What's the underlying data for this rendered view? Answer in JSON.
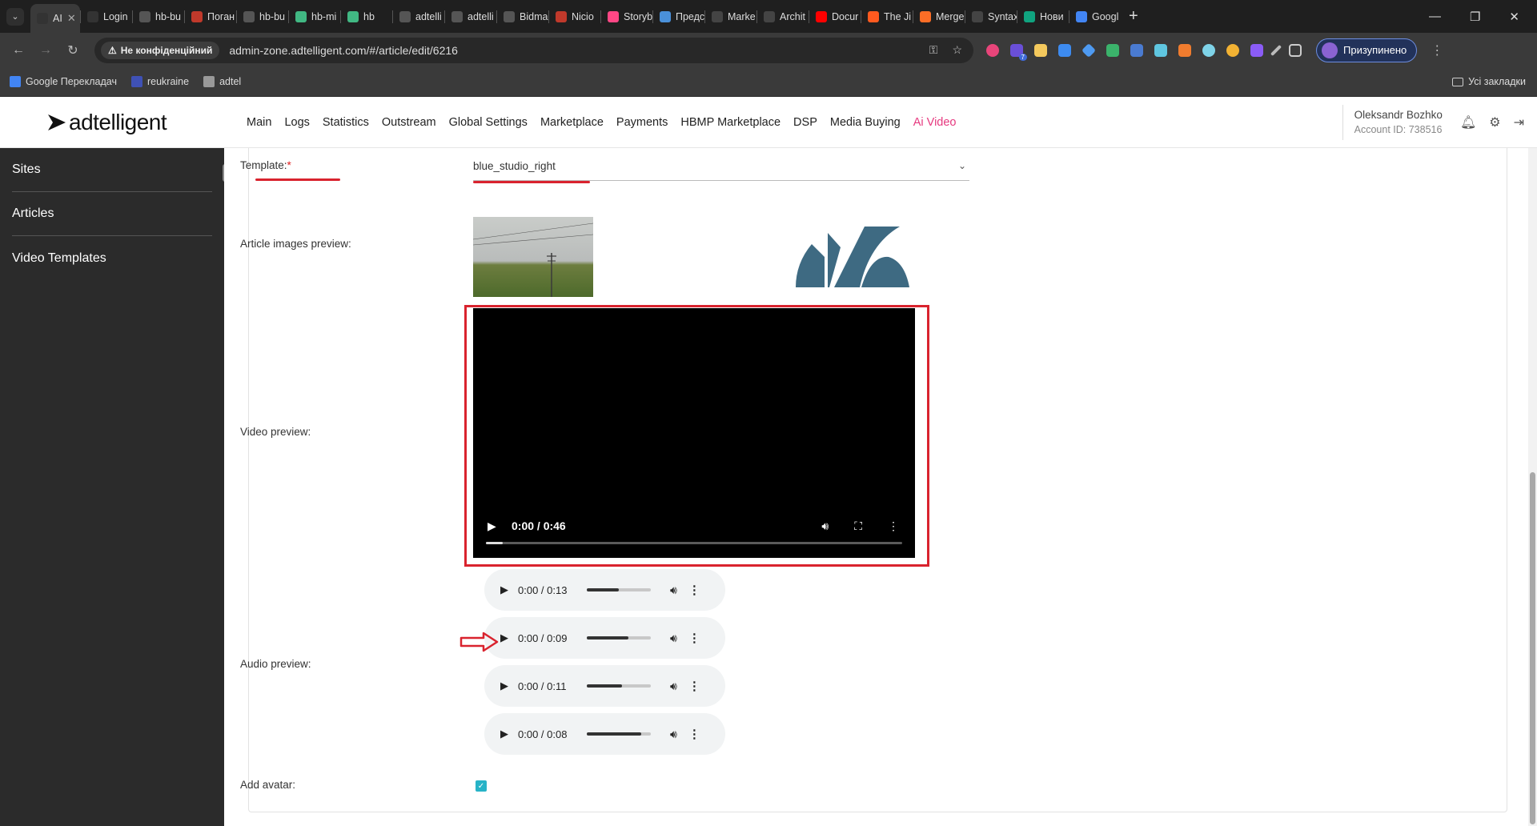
{
  "browser": {
    "tabs": [
      {
        "label": "AI",
        "icon": "adtelligent-icon",
        "color": "#333333",
        "active": true
      },
      {
        "label": "Login",
        "icon": "adtelligent-icon",
        "color": "#333333"
      },
      {
        "label": "hb-bu",
        "icon": "globe-icon",
        "color": "#555555"
      },
      {
        "label": "Поган",
        "icon": "bug-icon",
        "color": "#c0392b"
      },
      {
        "label": "hb-bu",
        "icon": "globe-icon",
        "color": "#555555"
      },
      {
        "label": "hb-mi",
        "icon": "vue-icon",
        "color": "#41b883"
      },
      {
        "label": "hb",
        "icon": "vue-icon",
        "color": "#41b883"
      },
      {
        "label": "adtelli",
        "icon": "globe-icon",
        "color": "#555555"
      },
      {
        "label": "adtelli",
        "icon": "globe-icon",
        "color": "#555555"
      },
      {
        "label": "Bidma",
        "icon": "globe-icon",
        "color": "#555555"
      },
      {
        "label": "Nicio",
        "icon": "book-icon",
        "color": "#c0392b"
      },
      {
        "label": "Storyb",
        "icon": "storybook-icon",
        "color": "#ff4785"
      },
      {
        "label": "Предс",
        "icon": "image-icon",
        "color": "#4a90d9"
      },
      {
        "label": "Marke",
        "icon": "x-icon",
        "color": "#444444"
      },
      {
        "label": "Archit",
        "icon": "notion-icon",
        "color": "#444444"
      },
      {
        "label": "Docur",
        "icon": "youtube-icon",
        "color": "#ff0000"
      },
      {
        "label": "The Ji",
        "icon": "flame-icon",
        "color": "#ff5a1f"
      },
      {
        "label": "Merge",
        "icon": "gitlab-icon",
        "color": "#fc6d26"
      },
      {
        "label": "Syntax",
        "icon": "x-icon",
        "color": "#444444"
      },
      {
        "label": "Нови",
        "icon": "chatgpt-icon",
        "color": "#10a37f"
      },
      {
        "label": "Googl",
        "icon": "translate-icon",
        "color": "#4285f4"
      }
    ],
    "omnibox": {
      "security_badge": "Не конфіденційний",
      "url": "admin-zone.adtelligent.com/#/article/edit/6216"
    },
    "profile_status": "Призупинено",
    "extension_badge": "7",
    "bookmarks": [
      {
        "label": "Google Перекладач",
        "icon": "translate-icon",
        "color": "#4285f4"
      },
      {
        "label": "reukraine",
        "icon": "reukraine-icon",
        "color": "#3f51b5"
      },
      {
        "label": "adtel",
        "icon": "folder-icon",
        "color": "#999999"
      }
    ],
    "all_bookmarks": "Усі закладки"
  },
  "app": {
    "logo_text": "adtelligent",
    "nav": [
      {
        "label": "Main"
      },
      {
        "label": "Logs"
      },
      {
        "label": "Statistics"
      },
      {
        "label": "Outstream"
      },
      {
        "label": "Global Settings"
      },
      {
        "label": "Marketplace"
      },
      {
        "label": "Payments"
      },
      {
        "label": "HBMP Marketplace"
      },
      {
        "label": "DSP"
      },
      {
        "label": "Media Buying"
      },
      {
        "label": "Ai Video",
        "active": true
      }
    ],
    "account": {
      "name": "Oleksandr Bozhko",
      "account_id": "Account ID: 738516"
    },
    "accent_color": "#e6397f"
  },
  "sidebar": {
    "items": [
      {
        "label": "Sites"
      },
      {
        "label": "Articles"
      },
      {
        "label": "Video Templates"
      }
    ]
  },
  "form": {
    "template_label": "Template:",
    "required_mark": "*",
    "template_value": "blue_studio_right",
    "images_label": "Article images preview:",
    "video_label": "Video preview:",
    "video": {
      "time": "0:00 / 0:46",
      "progress": 0.04
    },
    "audio_label": "Audio preview:",
    "audios": [
      {
        "time": "0:00 / 0:13",
        "volume": 0.5
      },
      {
        "time": "0:00 / 0:09",
        "volume": 0.65
      },
      {
        "time": "0:00 / 0:11",
        "volume": 0.55
      },
      {
        "time": "0:00 / 0:08",
        "volume": 0.85
      }
    ],
    "avatar_label": "Add avatar:",
    "avatar_checked": true
  },
  "annotation_color": "#d9232e"
}
